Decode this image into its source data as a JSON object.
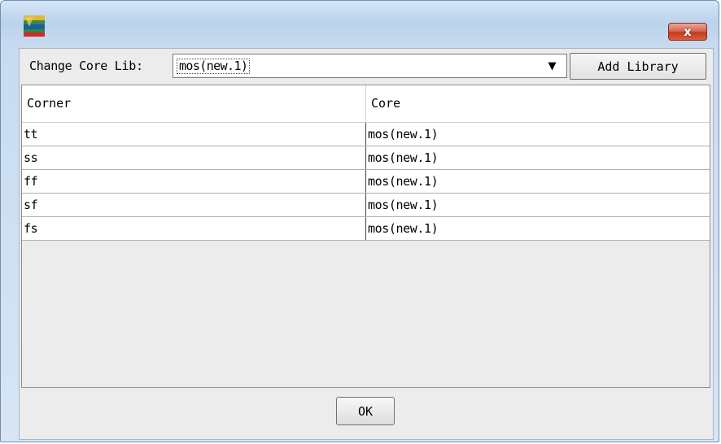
{
  "window": {
    "close_symbol": "x",
    "icon": "app-logo-icon"
  },
  "toolbar": {
    "lib_label": "Change Core Lib:",
    "lib_selected": "mos(new.1)",
    "dropdown_arrow": "▼",
    "add_library_label": "Add Library"
  },
  "table": {
    "columns": [
      "Corner",
      "Core"
    ],
    "rows": [
      [
        "tt",
        "mos(new.1)"
      ],
      [
        "ss",
        "mos(new.1)"
      ],
      [
        "ff",
        "mos(new.1)"
      ],
      [
        "sf",
        "mos(new.1)"
      ],
      [
        "fs",
        "mos(new.1)"
      ]
    ]
  },
  "footer": {
    "ok_label": "OK"
  },
  "colors": {
    "title_gradient_top": "#d6e6f6",
    "close_button": "#c4391f",
    "client_bg": "#ececec"
  }
}
